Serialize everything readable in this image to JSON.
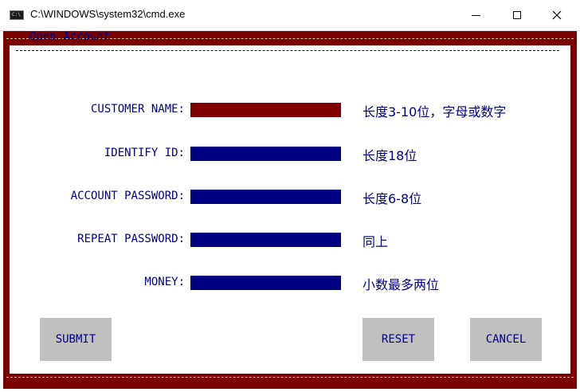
{
  "window": {
    "title": "C:\\WINDOWS\\system32\\cmd.exe",
    "close_glyph": "✕"
  },
  "form": {
    "title": "Open Account",
    "fields": [
      {
        "label": "CUSTOMER NAME:",
        "hint": "长度3-10位，字母或数字",
        "active": true
      },
      {
        "label": "IDENTIFY ID:",
        "hint": "长度18位",
        "active": false
      },
      {
        "label": "ACCOUNT PASSWORD:",
        "hint": "长度6-8位",
        "active": false
      },
      {
        "label": "REPEAT PASSWORD:",
        "hint": "同上",
        "active": false
      },
      {
        "label": "MONEY:",
        "hint": "小数最多两位",
        "active": false
      }
    ],
    "buttons": {
      "submit": "SUBMIT",
      "reset": "RESET",
      "cancel": "CANCEL"
    }
  },
  "colors": {
    "frame": "#7b0000",
    "text": "#000080",
    "field": "#000080",
    "field_active": "#800000",
    "button": "#c0c0c0"
  }
}
